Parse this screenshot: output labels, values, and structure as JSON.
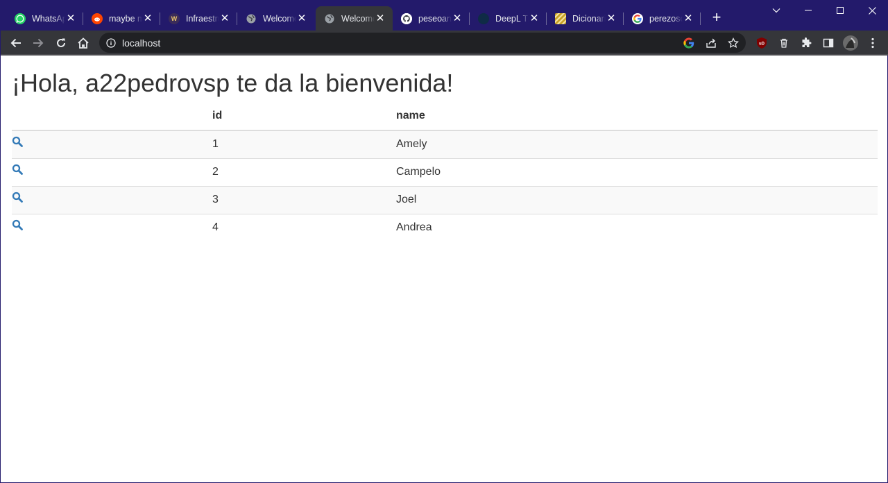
{
  "browser": {
    "tabs": [
      {
        "title": "WhatsApp",
        "icon": "whatsapp-icon",
        "color": "#25d366"
      },
      {
        "title": "maybe m",
        "icon": "reddit-icon",
        "color": "#ff4500"
      },
      {
        "title": "Infraestru",
        "icon": "w-logo-icon",
        "color": "#3b2c5a"
      },
      {
        "title": "Welcome",
        "icon": "globe-icon",
        "color": "#9aa0a6"
      },
      {
        "title": "Welcome",
        "icon": "globe-icon",
        "color": "#9aa0a6"
      },
      {
        "title": "peseoan",
        "icon": "github-icon",
        "color": "#ffffff"
      },
      {
        "title": "DeepL Tr",
        "icon": "deepl-icon",
        "color": "#0f2b46"
      },
      {
        "title": "Dicionari",
        "icon": "dictionary-icon",
        "color": "#c9a227"
      },
      {
        "title": "perezoso",
        "icon": "google-icon",
        "color": "#ffffff"
      }
    ],
    "active_tab": 4,
    "address": "localhost"
  },
  "page": {
    "heading": "¡Hola, a22pedrovsp te da la bienvenida!",
    "table": {
      "headers": [
        "",
        "id",
        "name"
      ],
      "rows": [
        {
          "id": "1",
          "name": "Amely"
        },
        {
          "id": "2",
          "name": "Campelo"
        },
        {
          "id": "3",
          "name": "Joel"
        },
        {
          "id": "4",
          "name": "Andrea"
        }
      ]
    }
  },
  "colors": {
    "titlebar": "#231a6b",
    "toolbar": "#35363a",
    "link_icon": "#337ab7",
    "text": "#333333"
  }
}
